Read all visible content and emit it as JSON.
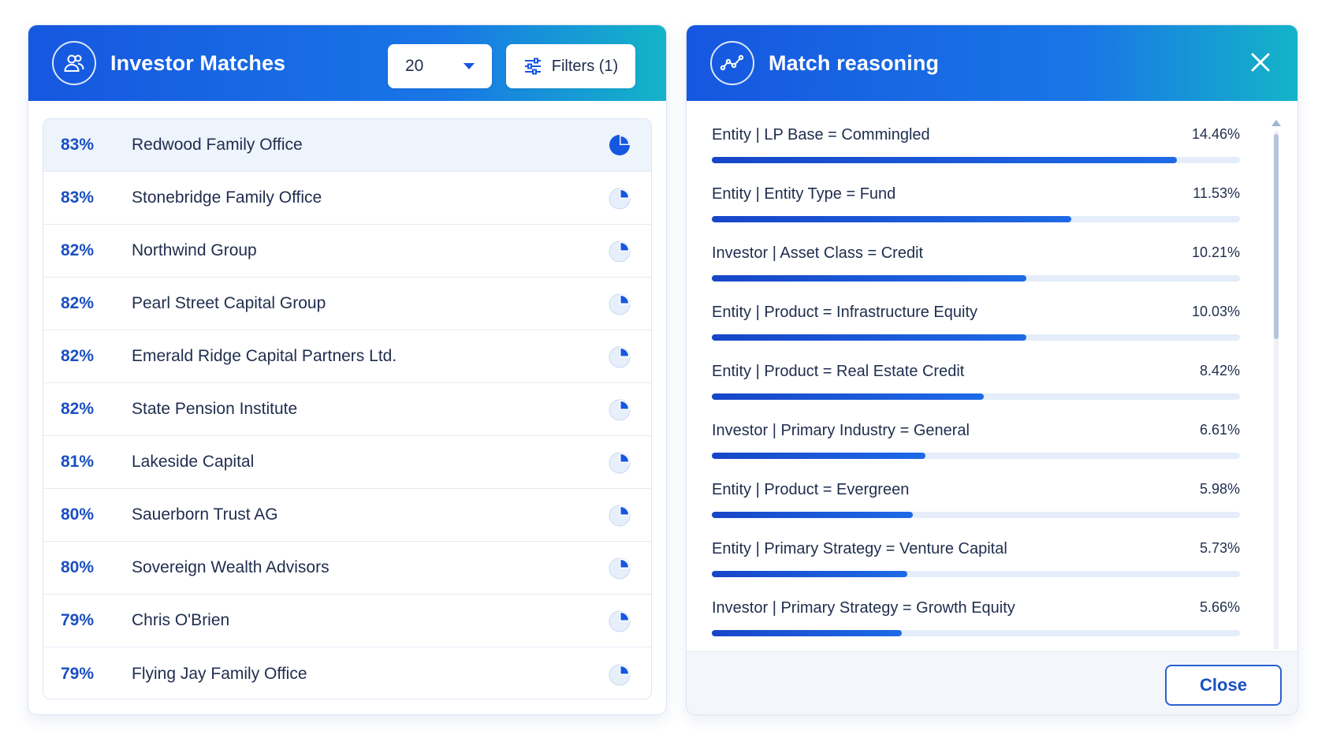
{
  "left": {
    "title": "Investor Matches",
    "count_value": "20",
    "filters_label": "Filters (1)",
    "rows": [
      {
        "pct": "83%",
        "name": "Redwood Family Office",
        "selected": true
      },
      {
        "pct": "83%",
        "name": "Stonebridge Family Office"
      },
      {
        "pct": "82%",
        "name": "Northwind Group"
      },
      {
        "pct": "82%",
        "name": "Pearl Street Capital Group"
      },
      {
        "pct": "82%",
        "name": "Emerald Ridge Capital Partners Ltd."
      },
      {
        "pct": "82%",
        "name": "State Pension Institute"
      },
      {
        "pct": "81%",
        "name": "Lakeside Capital"
      },
      {
        "pct": "80%",
        "name": "Sauerborn Trust AG"
      },
      {
        "pct": "80%",
        "name": "Sovereign Wealth Advisors"
      },
      {
        "pct": "79%",
        "name": "Chris O'Brien"
      },
      {
        "pct": "79%",
        "name": "Flying Jay Family Office"
      }
    ]
  },
  "right": {
    "title": "Match reasoning",
    "close_label": "Close",
    "reasons": [
      {
        "label": "Entity | LP Base = Commingled",
        "value": "14.46%",
        "fill": 0.88
      },
      {
        "label": "Entity | Entity Type = Fund",
        "value": "11.53%",
        "fill": 0.68
      },
      {
        "label": "Investor | Asset Class = Credit",
        "value": "10.21%",
        "fill": 0.595
      },
      {
        "label": "Entity | Product = Infrastructure Equity",
        "value": "10.03%",
        "fill": 0.595
      },
      {
        "label": "Entity | Product = Real Estate Credit",
        "value": "8.42%",
        "fill": 0.515
      },
      {
        "label": "Investor | Primary Industry = General",
        "value": "6.61%",
        "fill": 0.405
      },
      {
        "label": "Entity | Product = Evergreen",
        "value": "5.98%",
        "fill": 0.38
      },
      {
        "label": "Entity | Primary Strategy = Venture Capital",
        "value": "5.73%",
        "fill": 0.37
      },
      {
        "label": "Investor | Primary Strategy = Growth Equity",
        "value": "5.66%",
        "fill": 0.36
      }
    ]
  },
  "colors": {
    "accent": "#1657e0",
    "header_gradient_end": "#14b4c8",
    "percent_text": "#1a4fc2",
    "bar_track": "#e4edf9"
  },
  "icons": {
    "left_header": "users-icon",
    "right_header": "line-chart-icon",
    "filters": "sliders-icon",
    "row": "pie-chart-icon",
    "close": "close-icon"
  }
}
